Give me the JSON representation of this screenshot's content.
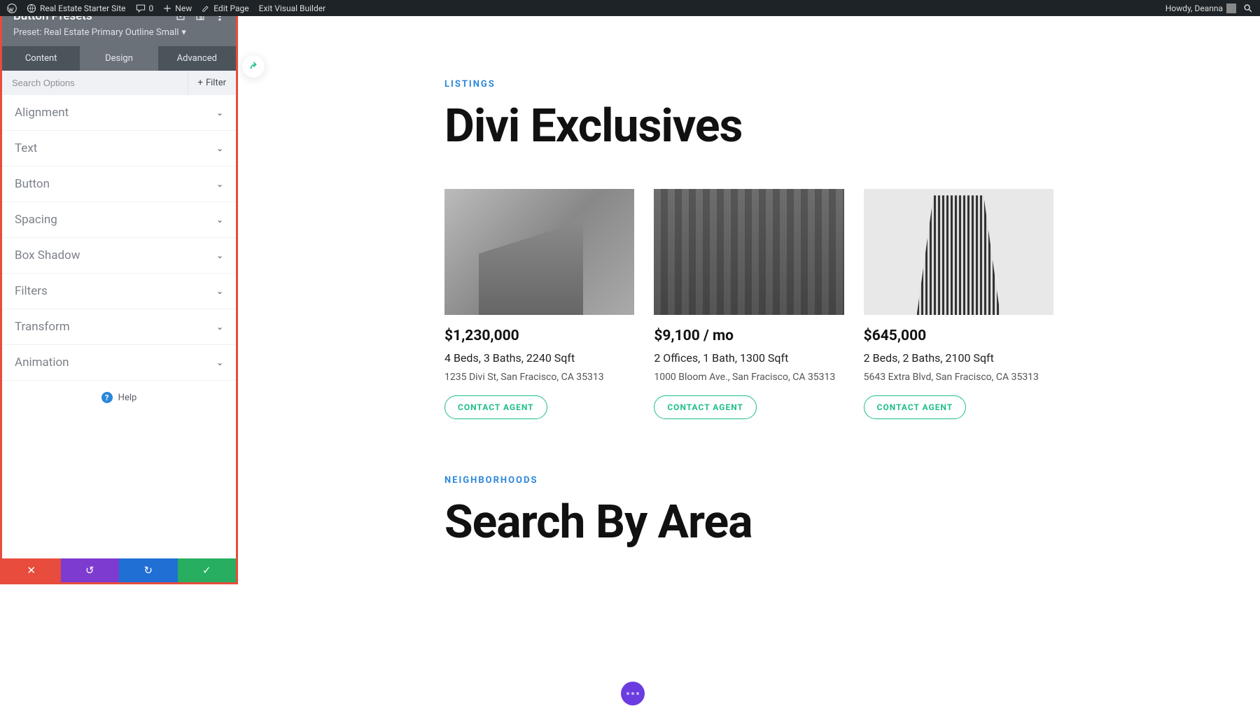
{
  "adminbar": {
    "site_name": "Real Estate Starter Site",
    "comments_count": "0",
    "new_label": "New",
    "edit_page_label": "Edit Page",
    "exit_vb_label": "Exit Visual Builder",
    "greeting": "Howdy, Deanna"
  },
  "sidebar": {
    "title": "Button Presets",
    "preset_label": "Preset: Real Estate Primary Outline Small",
    "tabs": {
      "content": "Content",
      "design": "Design",
      "advanced": "Advanced"
    },
    "search_placeholder": "Search Options",
    "filter_label": "Filter",
    "sections": [
      "Alignment",
      "Text",
      "Button",
      "Spacing",
      "Box Shadow",
      "Filters",
      "Transform",
      "Animation"
    ],
    "help_label": "Help"
  },
  "page": {
    "eyebrow1": "LISTINGS",
    "headline1": "Divi Exclusives",
    "eyebrow2": "NEIGHBORHOODS",
    "headline2": "Search By Area",
    "contact_label": "CONTACT AGENT",
    "listings": [
      {
        "price": "$1,230,000",
        "specs": "4 Beds, 3 Baths, 2240 Sqft",
        "address": "1235 Divi St, San Fracisco, CA 35313"
      },
      {
        "price": "$9,100 / mo",
        "specs": "2 Offices, 1 Bath, 1300 Sqft",
        "address": "1000 Bloom Ave., San Fracisco, CA 35313"
      },
      {
        "price": "$645,000",
        "specs": "2 Beds, 2 Baths, 2100 Sqft",
        "address": "5643 Extra Blvd, San Fracisco, CA 35313"
      }
    ]
  }
}
